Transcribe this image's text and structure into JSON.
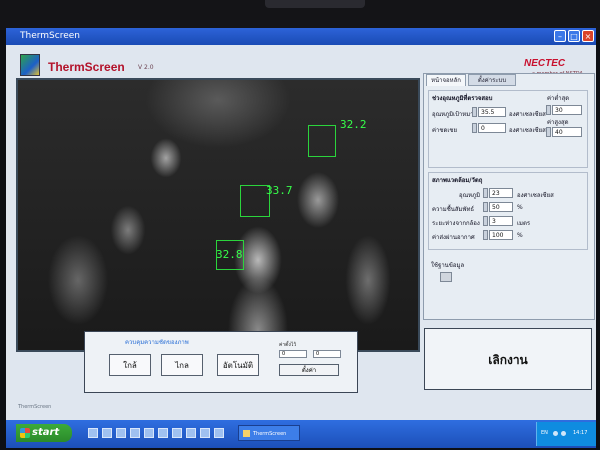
{
  "window": {
    "title": "ThermScreen"
  },
  "app": {
    "name": "ThermScreen",
    "version": "V 2.0",
    "brand": "NECTEC",
    "brand_sub": "a member of NSTDA"
  },
  "video": {
    "temps": [
      "32.2",
      "33.7",
      "32.8"
    ]
  },
  "tabs": [
    {
      "label": "หน้าจอหลัก",
      "active": true
    },
    {
      "label": "ตั้งค่าระบบ",
      "active": false
    }
  ],
  "threshold": {
    "title": "ช่วงอุณหภูมิที่ตรวจสอบ",
    "min_label": "ค่าต่ำสุด",
    "max_label": "ค่าสูงสุด",
    "trigger_label": "อุณหภูมิเป้าหมาย",
    "trigger_value": "35.5",
    "trigger_unit": "องศาเซลเซียส",
    "offset_label": "ค่าชดเชย",
    "offset_value": "0",
    "offset_unit": "องศาเซลเซียส",
    "min_value": "30",
    "max_value": "40"
  },
  "environment": {
    "title": "สภาพแวดล้อม/วัตถุ",
    "temp_label": "อุณหภูมิ",
    "temp_value": "23",
    "temp_unit": "องศาเซลเซียส",
    "humidity_label": "ความชื้นสัมพัทธ์",
    "humidity_value": "50",
    "humidity_unit": "%",
    "distance_label": "ระยะห่างจากกล้อง",
    "distance_value": "3",
    "distance_unit": "เมตร",
    "emissivity_label": "ค่าส่งผ่านอากาศ",
    "emissivity_value": "100",
    "emissivity_unit": "%"
  },
  "options": {
    "label": "ใช้ฐานข้อมูล"
  },
  "camera_control": {
    "title": "ควบคุมความชัดของภาพ",
    "near_label": "ใกล้",
    "far_label": "ไกล",
    "auto_label": "อัตโนมัติ",
    "preset_label": "ค่าตั้งไว้",
    "preset_a": "0",
    "preset_b": "0",
    "set_label": "ตั้งค่า"
  },
  "actions": {
    "stop_label": "เลิกงาน"
  },
  "status": {
    "text": "ThermScreen"
  },
  "taskbar": {
    "start_label": "start",
    "task_label": "ThermScreen",
    "lang": "EN",
    "clock": "14:17"
  }
}
